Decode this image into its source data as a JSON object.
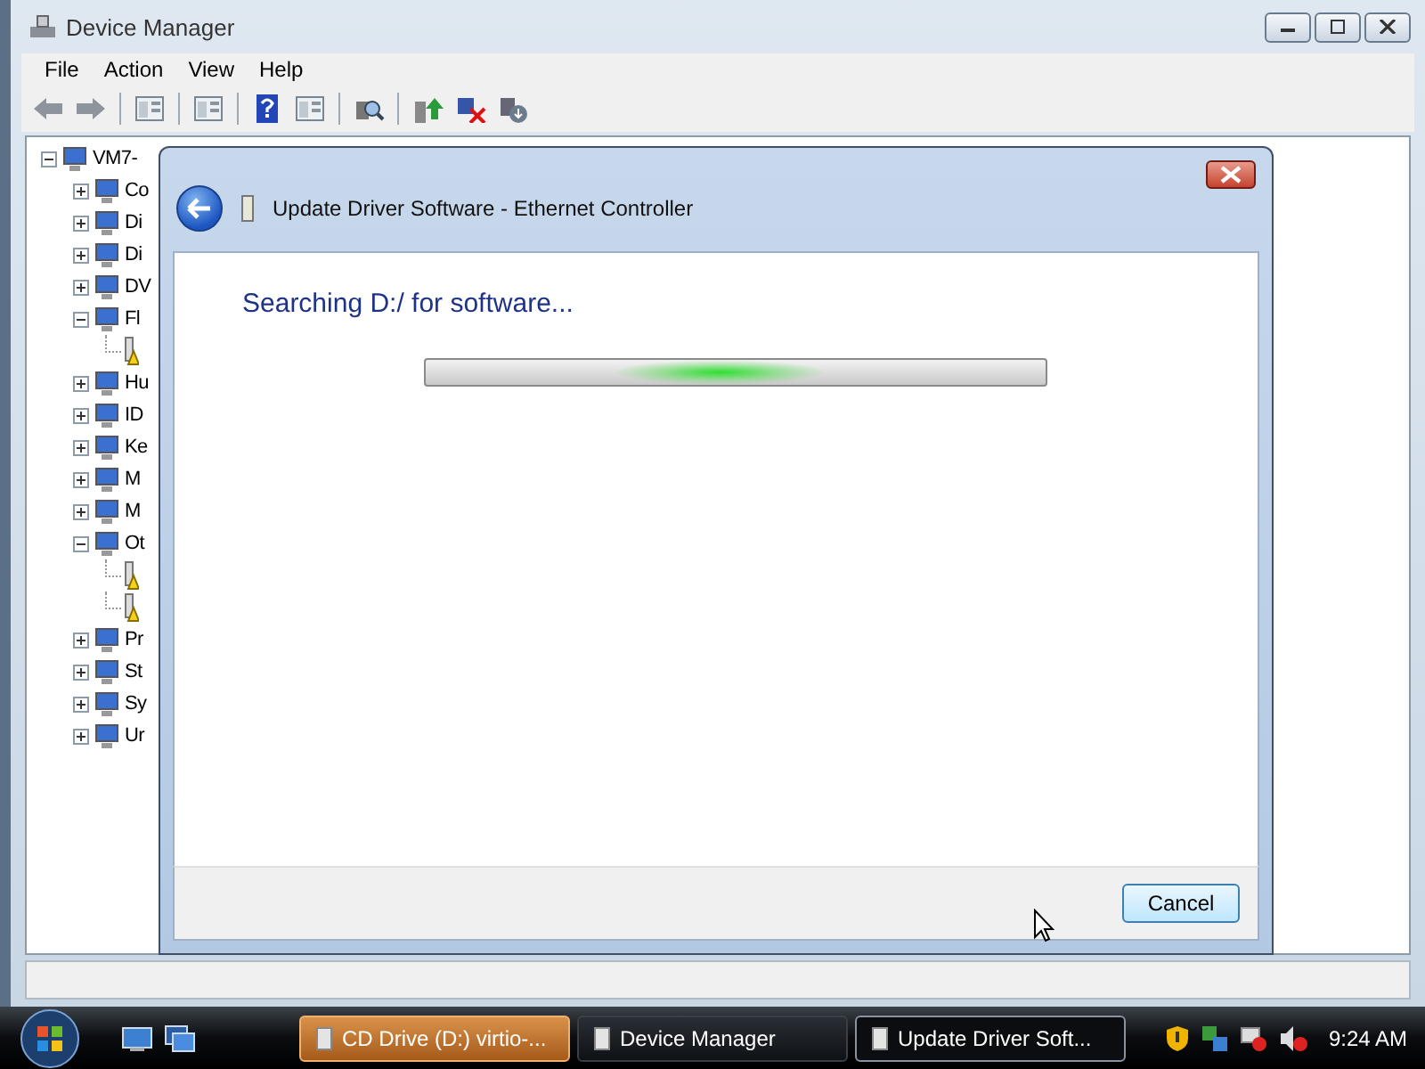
{
  "window": {
    "title": "Device Manager"
  },
  "menu": [
    "File",
    "Action",
    "View",
    "Help"
  ],
  "tree": [
    {
      "kind": "node",
      "label": "VM7-",
      "expanded": true,
      "children": [
        {
          "kind": "node",
          "label": "Co",
          "expanded": false
        },
        {
          "kind": "node",
          "label": "Di",
          "expanded": false
        },
        {
          "kind": "node",
          "label": "Di",
          "expanded": false
        },
        {
          "kind": "node",
          "label": "DV",
          "expanded": false
        },
        {
          "kind": "node",
          "label": "Fl",
          "expanded": true,
          "children": [
            {
              "kind": "leaf"
            }
          ]
        },
        {
          "kind": "node",
          "label": "Hu",
          "expanded": false
        },
        {
          "kind": "node",
          "label": "ID",
          "expanded": false
        },
        {
          "kind": "node",
          "label": "Ke",
          "expanded": false
        },
        {
          "kind": "node",
          "label": "M",
          "expanded": false
        },
        {
          "kind": "node",
          "label": "M",
          "expanded": false
        },
        {
          "kind": "node",
          "label": "Ot",
          "expanded": true,
          "children": [
            {
              "kind": "leaf"
            },
            {
              "kind": "leaf"
            }
          ]
        },
        {
          "kind": "node",
          "label": "Pr",
          "expanded": false
        },
        {
          "kind": "node",
          "label": "St",
          "expanded": false
        },
        {
          "kind": "node",
          "label": "Sy",
          "expanded": false
        },
        {
          "kind": "node",
          "label": "Ur",
          "expanded": false
        }
      ]
    }
  ],
  "dialog": {
    "title": "Update Driver Software - Ethernet Controller",
    "heading": "Searching D:/ for software...",
    "progress": {
      "kind": "marquee"
    },
    "buttons": [
      "Cancel"
    ]
  },
  "taskbar": {
    "tasks": [
      {
        "label": "CD Drive (D:) virtio-...",
        "flashing": true,
        "selected": false
      },
      {
        "label": "Device Manager",
        "flashing": false,
        "selected": false
      },
      {
        "label": "Update Driver Soft...",
        "flashing": false,
        "selected": true
      }
    ],
    "clock": "9:24 AM"
  }
}
